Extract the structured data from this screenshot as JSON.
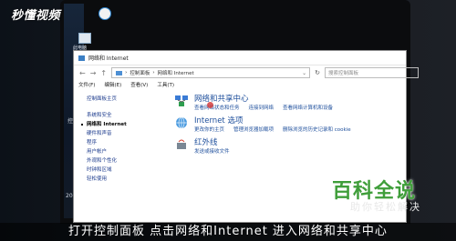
{
  "watermark": {
    "brand": "秒懂视频",
    "baike_title": "百科全说",
    "baike_subtitle": "助你轻松解决"
  },
  "desktop": {
    "icon_label": "此电脑",
    "side_fragment_1": "控",
    "side_fragment_2": "201"
  },
  "window": {
    "title": "网络和 Internet",
    "address": {
      "root": "控制面板",
      "current": "网络和 Internet",
      "separator": "›"
    },
    "search_placeholder": "搜索控制面板",
    "menu": [
      "文件(F)",
      "编辑(E)",
      "查看(V)",
      "工具(T)"
    ],
    "nav": {
      "home": "控制面板主页",
      "items": [
        {
          "label": "系统和安全",
          "current": false
        },
        {
          "label": "网络和 Internet",
          "current": true
        },
        {
          "label": "硬件和声音",
          "current": false
        },
        {
          "label": "程序",
          "current": false
        },
        {
          "label": "用户帐户",
          "current": false
        },
        {
          "label": "外观和个性化",
          "current": false
        },
        {
          "label": "时钟和区域",
          "current": false
        },
        {
          "label": "轻松使用",
          "current": false
        }
      ]
    },
    "categories": [
      {
        "title": "网络和共享中心",
        "icon": "network-icon",
        "links": [
          "查看网络状态和任务",
          "连接到网络",
          "查看网络计算机和设备"
        ]
      },
      {
        "title": "Internet 选项",
        "icon": "internet-options-icon",
        "links": [
          "更改你的主页",
          "管理浏览器加载项",
          "删除浏览的历史记录和 cookie"
        ]
      },
      {
        "title": "红外线",
        "icon": "infrared-icon",
        "links": [
          "发送或接收文件"
        ]
      }
    ]
  },
  "subtitle": "打开控制面板 点击网络和Internet 进入网络和共享中心",
  "colors": {
    "link": "#1e4f9c",
    "baike_green": "#3f9e3a"
  }
}
